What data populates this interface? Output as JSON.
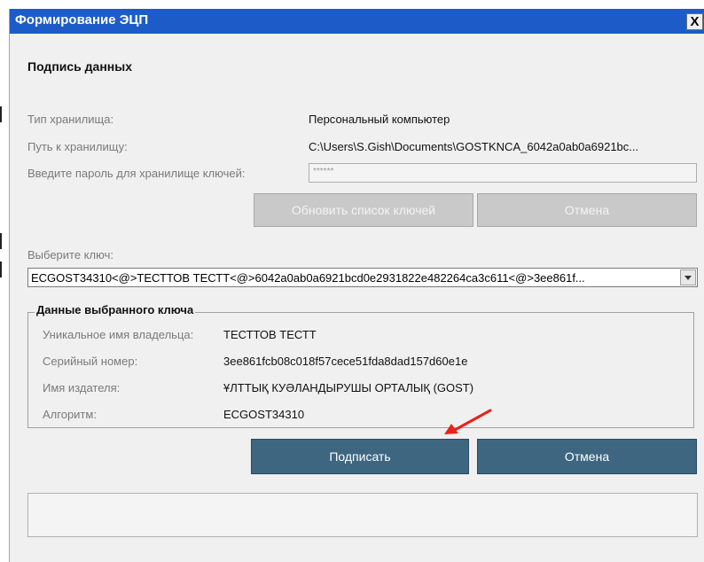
{
  "window": {
    "title": "Формирование ЭЦП",
    "close_label": "X"
  },
  "section_title": "Подпись данных",
  "store": {
    "type_label": "Тип хранилища:",
    "type_value": "Персональный компьютер",
    "path_label": "Путь к хранилищу:",
    "path_value": "C:\\Users\\S.Gish\\Documents\\GOSTKNCA_6042a0ab0a6921bc...",
    "password_label": "Введите пароль для хранилище ключей:",
    "password_value": "******"
  },
  "buttons": {
    "refresh": "Обновить список ключей",
    "cancel_top": "Отмена",
    "sign": "Подписать",
    "cancel_bottom": "Отмена"
  },
  "key_select": {
    "label": "Выберите ключ:",
    "value": "ECGOST34310<@>ТЕСТТОВ ТЕСТТ<@>6042a0ab0a6921bcd0e2931822e482264ca3c611<@>3ee861f..."
  },
  "key_info": {
    "legend": "Данные выбранного ключа",
    "owner_label": "Уникальное имя владельца:",
    "owner_value": "ТЕСТТОВ ТЕСТТ",
    "serial_label": "Серийный номер:",
    "serial_value": "3ee861fcb08c018f57cece51fda8dad157d60e1e",
    "issuer_label": "Имя издателя:",
    "issuer_value": "ҰЛТТЫҚ КУӘЛАНДЫРУШЫ ОРТАЛЫҚ (GOST)",
    "algorithm_label": "Алгоритм:",
    "algorithm_value": "ECGOST34310"
  },
  "colors": {
    "titlebar": "#1d5cc8",
    "primary_button": "#3e6681",
    "annotation_arrow": "#e8231c"
  },
  "icons": {
    "close": "close-icon",
    "dropdown": "chevron-down-icon",
    "annotation": "red-arrow-icon"
  }
}
